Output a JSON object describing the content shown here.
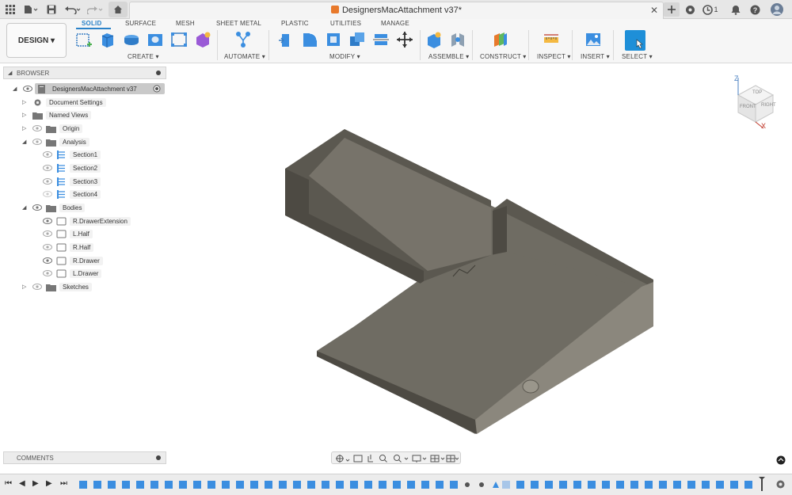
{
  "title_bar": {
    "document_title": "DesignersMacAttachment v37*",
    "notification_count": "1"
  },
  "toolbar": {
    "workspace_button": "DESIGN ▾",
    "tabs": [
      "SOLID",
      "SURFACE",
      "MESH",
      "SHEET METAL",
      "PLASTIC",
      "UTILITIES",
      "MANAGE"
    ],
    "active_tab": "SOLID",
    "groups": [
      "CREATE ▾",
      "AUTOMATE ▾",
      "MODIFY ▾",
      "ASSEMBLE ▾",
      "CONSTRUCT ▾",
      "INSPECT ▾",
      "INSERT ▾",
      "SELECT ▾"
    ]
  },
  "browser": {
    "header": "BROWSER",
    "root": "DesignersMacAttachment v37",
    "items": [
      {
        "label": "Document Settings"
      },
      {
        "label": "Named Views"
      },
      {
        "label": "Origin"
      },
      {
        "label": "Analysis"
      },
      {
        "label": "Section1"
      },
      {
        "label": "Section2"
      },
      {
        "label": "Section3"
      },
      {
        "label": "Section4"
      },
      {
        "label": "Bodies"
      },
      {
        "label": "R.DrawerExtension"
      },
      {
        "label": "L.Half"
      },
      {
        "label": "R.Half"
      },
      {
        "label": "R.Drawer"
      },
      {
        "label": "L.Drawer"
      },
      {
        "label": "Sketches"
      }
    ]
  },
  "viewcube": {
    "top": "TOP",
    "front": "FRONT",
    "right": "RIGHT",
    "z_axis": "Z",
    "x_axis": "X"
  },
  "comments": {
    "header": "COMMENTS"
  },
  "colors": {
    "accent": "#2a82c8",
    "model": "#6f6c63",
    "model_dark": "#4d4a43",
    "model_light": "#8b877d"
  }
}
